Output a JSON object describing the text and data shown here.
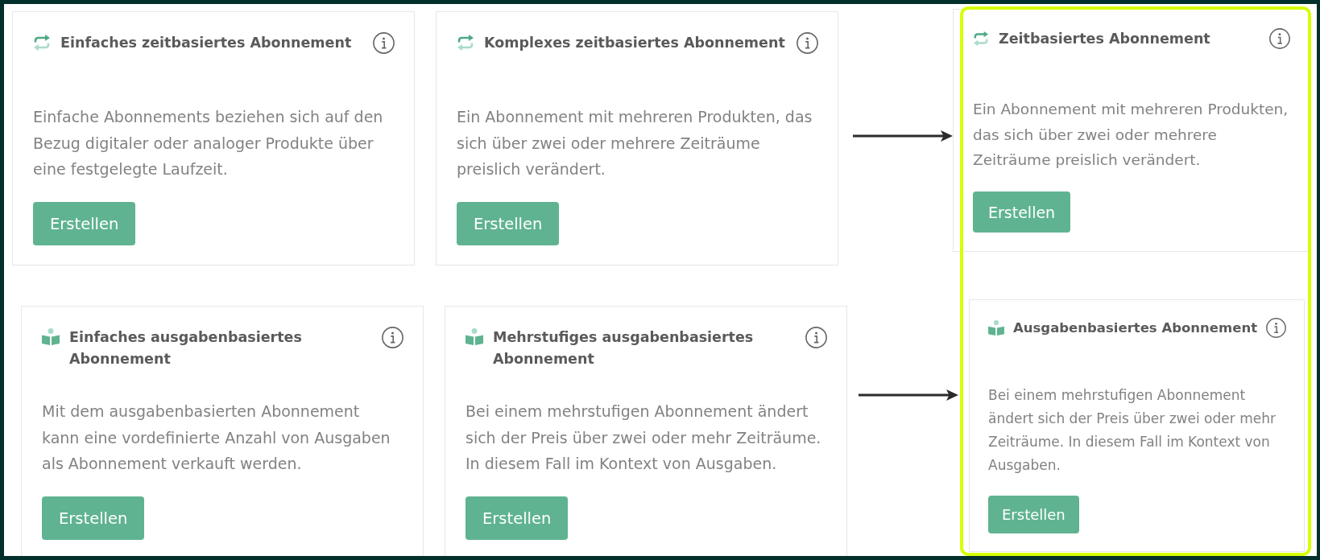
{
  "rows": [
    {
      "cards": [
        {
          "kind": "time",
          "title": "Einfaches zeitbasiertes Abonnement",
          "description": "Einfache Abonnements beziehen sich auf den Bezug digitaler oder analoger Produkte über eine festgelegte Laufzeit.",
          "button": "Erstellen"
        },
        {
          "kind": "time",
          "title": "Komplexes zeitbasiertes Abonnement",
          "description": "Ein Abonnement mit mehreren Produkten, das sich über zwei oder mehrere Zeiträume preislich verändert.",
          "button": "Erstellen"
        }
      ],
      "merged_card": {
        "kind": "time",
        "title": "Zeitbasiertes Abonnement",
        "description": "Ein Abonnement mit mehreren Produkten, das sich über zwei oder mehrere Zeiträume preislich verändert.",
        "button": "Erstellen"
      }
    },
    {
      "cards": [
        {
          "kind": "issue",
          "title": "Einfaches ausgabenbasiertes Abonnement",
          "description": "Mit dem ausgabenbasierten Abonnement kann eine vordefinierte Anzahl von Ausgaben als Abonnement verkauft werden.",
          "button": "Erstellen"
        },
        {
          "kind": "issue",
          "title": "Mehrstufiges ausgabenbasiertes Abonnement",
          "description": "Bei einem mehrstufigen Abonnement ändert sich der Preis über zwei oder mehr Zeiträume. In diesem Fall im Kontext von Ausgaben.",
          "button": "Erstellen"
        }
      ],
      "merged_card": {
        "kind": "issue",
        "title": "Ausgabenbasiertes Abonnement",
        "description": "Bei einem mehrstufigen Abonnement ändert sich der Preis über zwei oder mehr Zeiträume. In diesem Fall im Kontext von Ausgaben.",
        "button": "Erstellen"
      }
    }
  ]
}
